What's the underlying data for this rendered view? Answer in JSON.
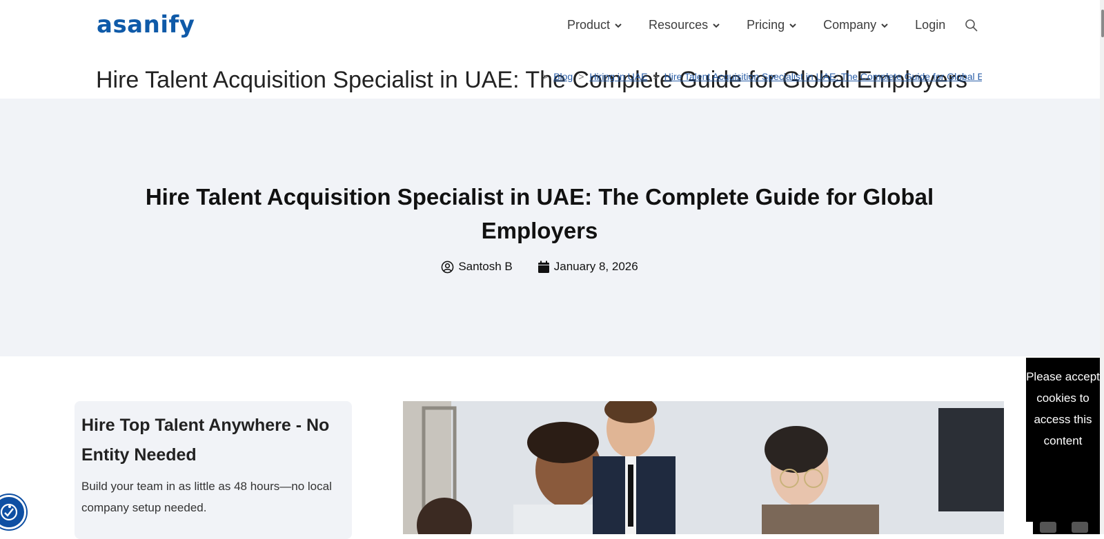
{
  "header": {
    "logo": "asanify",
    "nav": [
      {
        "label": "Product"
      },
      {
        "label": "Resources"
      },
      {
        "label": "Pricing"
      },
      {
        "label": "Company"
      }
    ],
    "login": "Login"
  },
  "page_title": "Hire Talent Acquisition Specialist in UAE: The Complete Guide for Global Employers",
  "breadcrumb": {
    "items": [
      "Blog",
      "Hiring in UAE",
      "Hire Talent Acquisition Specialist in UAE: The Complete Guide for Global E"
    ],
    "separator": ">"
  },
  "hero": {
    "title": "Hire Talent Acquisition Specialist in UAE: The Complete Guide for Global Employers",
    "author": "Santosh B",
    "date": "January 8, 2026"
  },
  "card": {
    "title": "Hire Top Talent Anywhere - No Entity Needed",
    "text": "Build your team in as little as 48 hours—no local company setup needed."
  },
  "cookie": {
    "message": "Please accept cookies to access this content"
  },
  "colors": {
    "brand": "#0f5aa8",
    "hero_bg": "#f1f3f7",
    "link": "#2b5fa8",
    "a11y": "#0e4fa3"
  }
}
